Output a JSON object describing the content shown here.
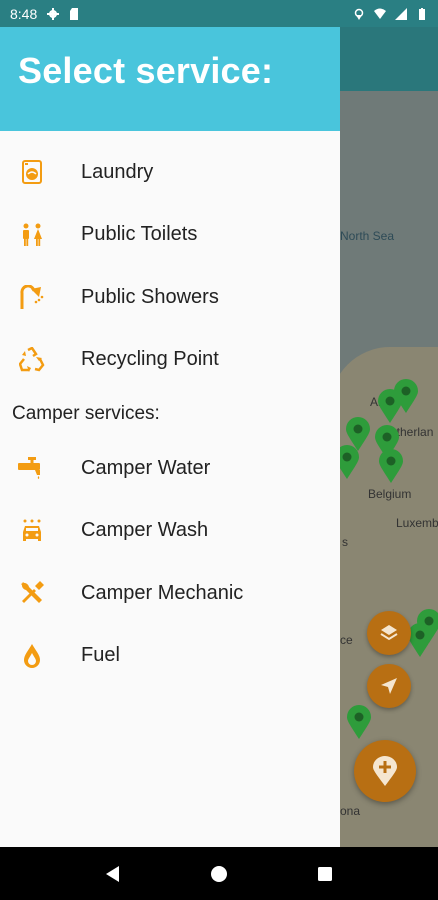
{
  "status_bar": {
    "time": "8:48"
  },
  "drawer": {
    "title": "Select service:",
    "items": [
      {
        "label": "Laundry",
        "icon": "laundry-icon"
      },
      {
        "label": "Public Toilets",
        "icon": "toilets-icon"
      },
      {
        "label": "Public Showers",
        "icon": "shower-icon"
      },
      {
        "label": "Recycling Point",
        "icon": "recycling-icon"
      }
    ],
    "camper_section_label": "Camper services:",
    "camper_items": [
      {
        "label": "Camper Water",
        "icon": "water-tap-icon"
      },
      {
        "label": "Camper Wash",
        "icon": "car-wash-icon"
      },
      {
        "label": "Camper Mechanic",
        "icon": "mechanic-tools-icon"
      },
      {
        "label": "Fuel",
        "icon": "fuel-drop-icon"
      }
    ]
  },
  "map": {
    "labels": {
      "north_sea": "North Sea",
      "netherlands": "etherlan",
      "amsterdam": "Ar",
      "belgium": "Belgium",
      "luxembourg": "Luxemb",
      "partial_s": "s",
      "partial_ce": "ce",
      "partial_ona": "ona"
    }
  },
  "colors": {
    "accent": "#f39c12",
    "header": "#49c5dc",
    "pin": "#2e9c3b",
    "fab": "#b86f13"
  }
}
